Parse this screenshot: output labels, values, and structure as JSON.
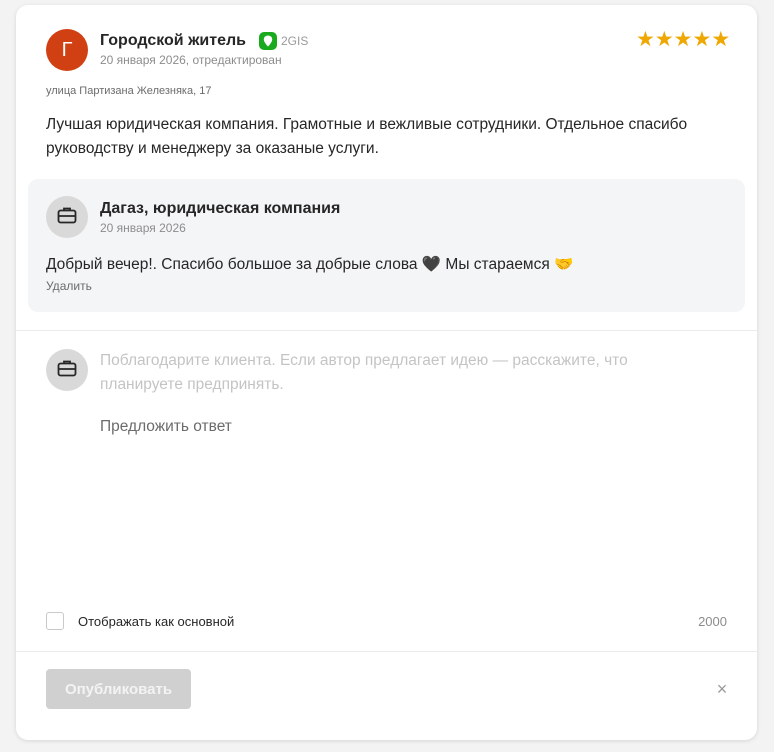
{
  "review": {
    "avatar_letter": "Г",
    "author": "Городской житель",
    "source": "2GIS",
    "date": "20 января 2026, отредактирован",
    "rating": 5,
    "address": "улица Партизана Железняка, 17",
    "text": "Лучшая юридическая компания. Грамотные и вежливые сотрудники. Отдельное спасибо руководству и менеджеру за оказаные услуги."
  },
  "reply": {
    "company": "Дагаз, юридическая компания",
    "date": "20 января 2026",
    "text": "Добрый вечер!. Спасибо большое за добрые слова 🖤 Мы стараемся 🤝",
    "delete_label": "Удалить"
  },
  "compose": {
    "placeholder": "Поблагодарите клиента. Если автор предлагает идею — расскажите, что планируете предпринять.",
    "suggest_label": "Предложить ответ",
    "show_main_label": "Отображать как основной",
    "char_count": "2000",
    "publish_label": "Опубликовать",
    "close_symbol": "×"
  },
  "colors": {
    "avatar": "#d14012",
    "star": "#efa701",
    "source_badge": "#19aa1e",
    "publish_disabled": "#d0d0d0"
  },
  "icons": {
    "source": "2gis-pin-icon",
    "company": "briefcase-icon",
    "close": "close-icon",
    "rating": "star-icon"
  }
}
